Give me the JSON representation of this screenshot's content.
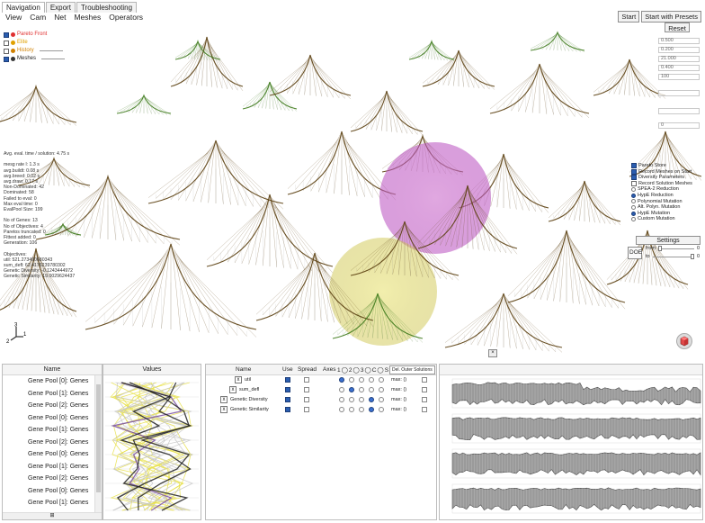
{
  "tabs": [
    "Navigation",
    "Export",
    "Troubleshooting"
  ],
  "menu": [
    "View",
    "Cam",
    "Net",
    "Meshes",
    "Operators"
  ],
  "buttons": {
    "start": "Start",
    "start_presets": "Start with Presets",
    "reset": "Reset",
    "settings": "Settings",
    "doe": "DOE",
    "del_outer": "Del. Outer Solutions"
  },
  "legend": [
    {
      "label": "Pareto Front",
      "color": "#e03030",
      "checked": true
    },
    {
      "label": "Elite",
      "color": "#e0a000",
      "checked": false
    },
    {
      "label": "History",
      "color": "#d08000",
      "checked": false
    },
    {
      "label": "Meshes",
      "color": "#333333",
      "checked": true
    }
  ],
  "stats": [
    "Avg. eval. time / solution: 4.75 s",
    "",
    "mesg rate l: 1.3 s",
    "avg.buildt: 0.08 s",
    "avg.breed: 0.02 s",
    "avg.draw: 0.17 s",
    "Non-Dominated: 42",
    "Dominated: 58",
    "Failed to eval: 0",
    "Max eval time: 0",
    "EvalPool Size: 199",
    "",
    "No of Genes: 13",
    "No of Objectives: 4",
    "Paretos truncated: 0",
    "Fittest added: 0",
    "Generation: 106",
    "",
    "Objectives:",
    "util: 521.273490680343",
    "sum_defl: 62.4176239780302",
    "Genetic Diversity: -0.1243444972",
    "Genetic Similarity: 19.0029624437"
  ],
  "right_fields": [
    "0.500",
    "0.200",
    "21.000",
    "0.400",
    "100",
    "",
    "",
    "0"
  ],
  "options": [
    {
      "label": "Pareto Store",
      "kind": "check",
      "on": true
    },
    {
      "label": "Record Meshes on Start",
      "kind": "check",
      "on": true
    },
    {
      "label": "Diversity Parameters",
      "kind": "check",
      "on": true
    },
    {
      "label": "Record Solution Meshes",
      "kind": "check",
      "on": false
    },
    {
      "label": "SPEA-2 Reduction",
      "kind": "radio",
      "on": false
    },
    {
      "label": "HypE Reduction",
      "kind": "radio",
      "on": true
    },
    {
      "label": "Polynomial Mutation",
      "kind": "radio",
      "on": false
    },
    {
      "label": "Alt. Polyn. Mutation",
      "kind": "radio",
      "on": false
    },
    {
      "label": "HypE Mutation",
      "kind": "radio",
      "on": true
    },
    {
      "label": "Custom Mutation",
      "kind": "radio",
      "on": false
    }
  ],
  "fromto": {
    "from_label": "from",
    "from_value": "0",
    "to_label": "to",
    "to_value": "0"
  },
  "gene_pane": {
    "name_header": "Name",
    "values_header": "Values",
    "rows": [
      "Gene Pool [0]: Genes",
      "Gene Pool [1]: Genes",
      "Gene Pool [2]: Genes",
      "Gene Pool [0]: Genes",
      "Gene Pool [1]: Genes",
      "Gene Pool [2]: Genes",
      "Gene Pool [0]: Genes",
      "Gene Pool [1]: Genes",
      "Gene Pool [2]: Genes",
      "Gene Pool [0]: Genes",
      "Gene Pool [1]: Genes"
    ]
  },
  "objectives_pane": {
    "headers": {
      "name": "Name",
      "use": "Use",
      "spread": "Spread",
      "axes": "Axes",
      "axes_labels": [
        "1",
        "2",
        "3",
        "C",
        "S"
      ]
    },
    "rows": [
      {
        "name": "util",
        "use": true,
        "spread": false,
        "axis_selected": 0,
        "max_label": "max: ()"
      },
      {
        "name": "sum_defl",
        "use": true,
        "spread": false,
        "axis_selected": 1,
        "max_label": "max: ()"
      },
      {
        "name": "Genetic Diversity",
        "use": true,
        "spread": false,
        "axis_selected": 3,
        "max_label": "max: ()"
      },
      {
        "name": "Genetic Similarity",
        "use": true,
        "spread": false,
        "axis_selected": 3,
        "max_label": "max: ()"
      }
    ]
  },
  "axis_glyph": {
    "x": "1",
    "y": "3",
    "z": "2"
  },
  "colors": {
    "mesh_dark": "#5b3f10",
    "mesh_green": "#3d7a1a",
    "pareto_magenta": "#c964c9",
    "pareto_yellow": "#d9d25a",
    "accent": "#2a5db0"
  }
}
